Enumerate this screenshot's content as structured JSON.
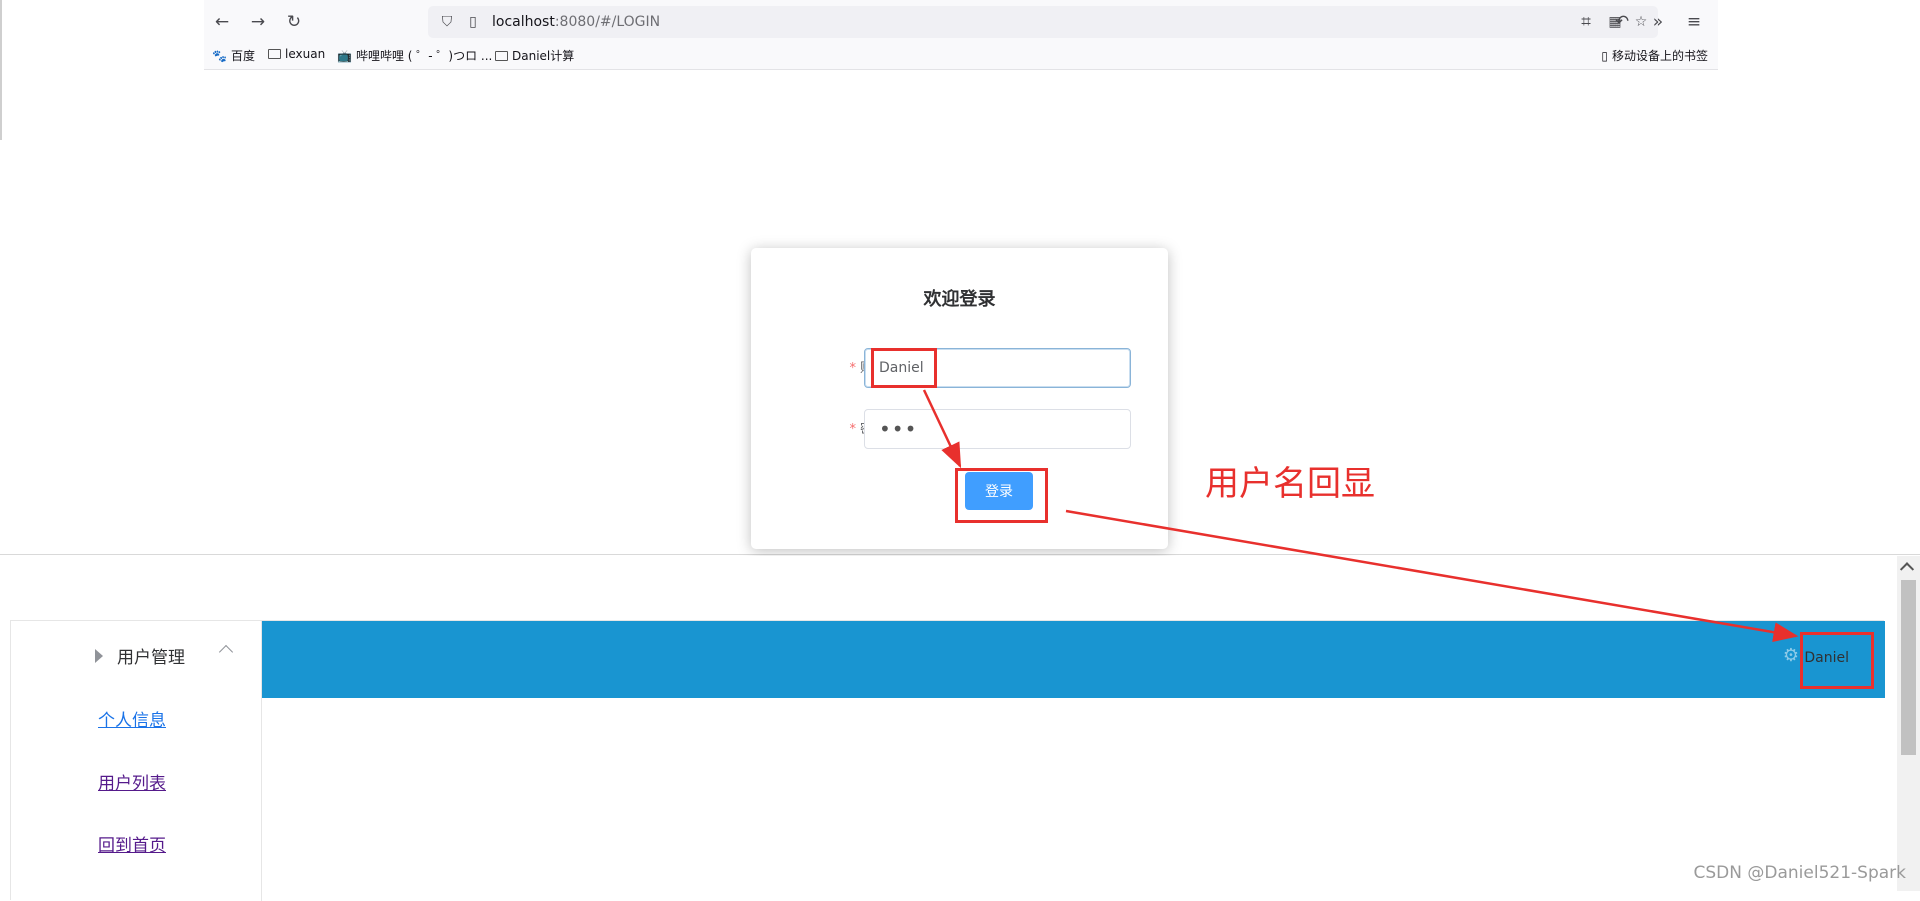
{
  "browser": {
    "url_host": "localhost",
    "url_rest": ":8080/#/LOGIN",
    "bookmarks": [
      {
        "icon": "baidu-icon",
        "label": "百度"
      },
      {
        "icon": "folder-icon",
        "label": "lexuan"
      },
      {
        "icon": "bilibili-icon",
        "label": "哔哩哔哩 ( ゜- ゜)つロ ..."
      },
      {
        "icon": "folder-icon",
        "label": "Daniel计算"
      }
    ],
    "mobile_bookmarks": "移动设备上的书签"
  },
  "login": {
    "title": "欢迎登录",
    "account_label": "账号",
    "account_value": "Daniel",
    "password_label": "密码",
    "password_value": "•••",
    "submit_label": "登录"
  },
  "annotation": {
    "text": "用户名回显",
    "color": "#e8302d"
  },
  "app": {
    "sidebar": {
      "menu_title": "用户管理",
      "links": [
        "个人信息",
        "用户列表",
        "回到首页"
      ]
    },
    "header": {
      "username": "Daniel",
      "color": "#1995d1"
    }
  },
  "watermark": "CSDN @Daniel521-Spark"
}
